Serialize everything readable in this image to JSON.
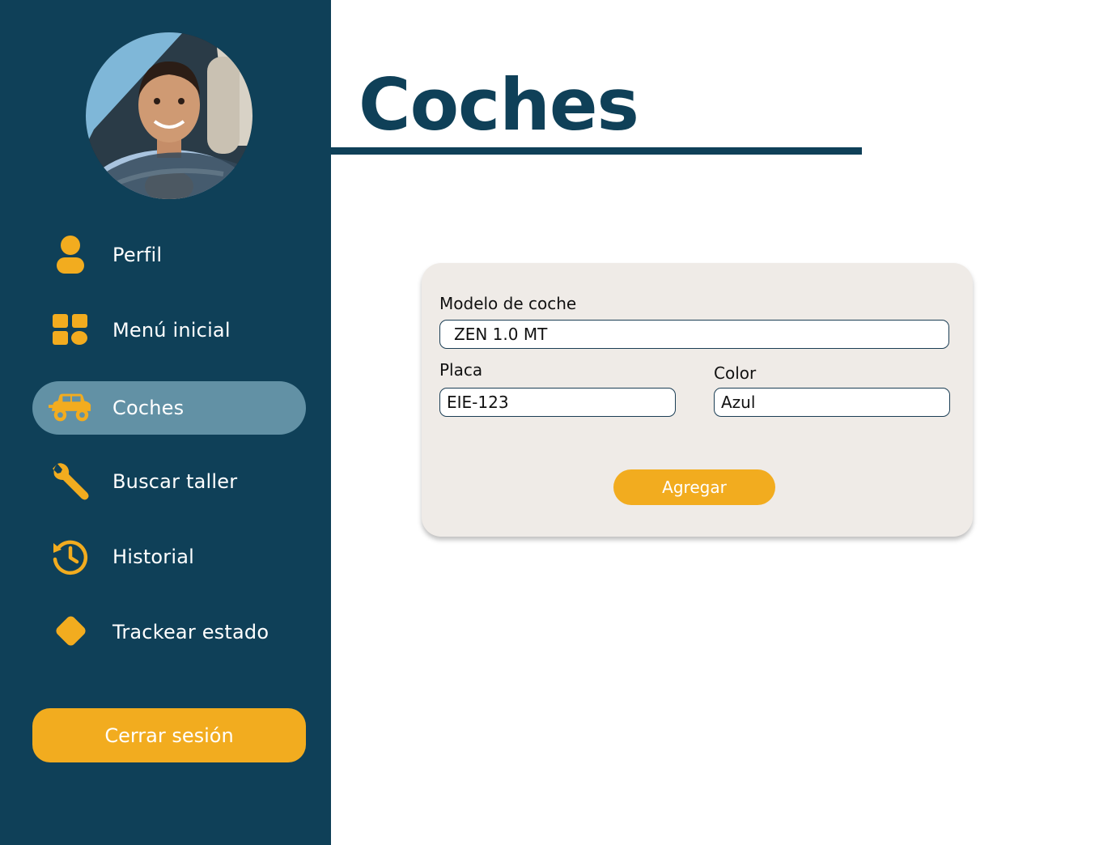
{
  "sidebar": {
    "items": [
      {
        "label": "Perfil",
        "icon": "user-icon"
      },
      {
        "label": "Menú inicial",
        "icon": "grid-icon"
      },
      {
        "label": "Coches",
        "icon": "car-icon",
        "active": true
      },
      {
        "label": "Buscar taller",
        "icon": "wrench-icon"
      },
      {
        "label": "Historial",
        "icon": "history-icon"
      },
      {
        "label": "Trackear estado",
        "icon": "diamond-icon"
      }
    ],
    "logout_label": "Cerrar sesión"
  },
  "header": {
    "title": "Coches"
  },
  "form": {
    "model_label": "Modelo de coche",
    "model_value": "ZEN 1.0 MT",
    "plate_label": "Placa",
    "plate_value": "EIE-123",
    "color_label": "Color",
    "color_value": "Azul",
    "submit_label": "Agregar"
  },
  "colors": {
    "sidebar_bg": "#0f4058",
    "accent": "#f2ac1f",
    "active_item": "#6291a5",
    "card_bg": "#efebe7"
  }
}
